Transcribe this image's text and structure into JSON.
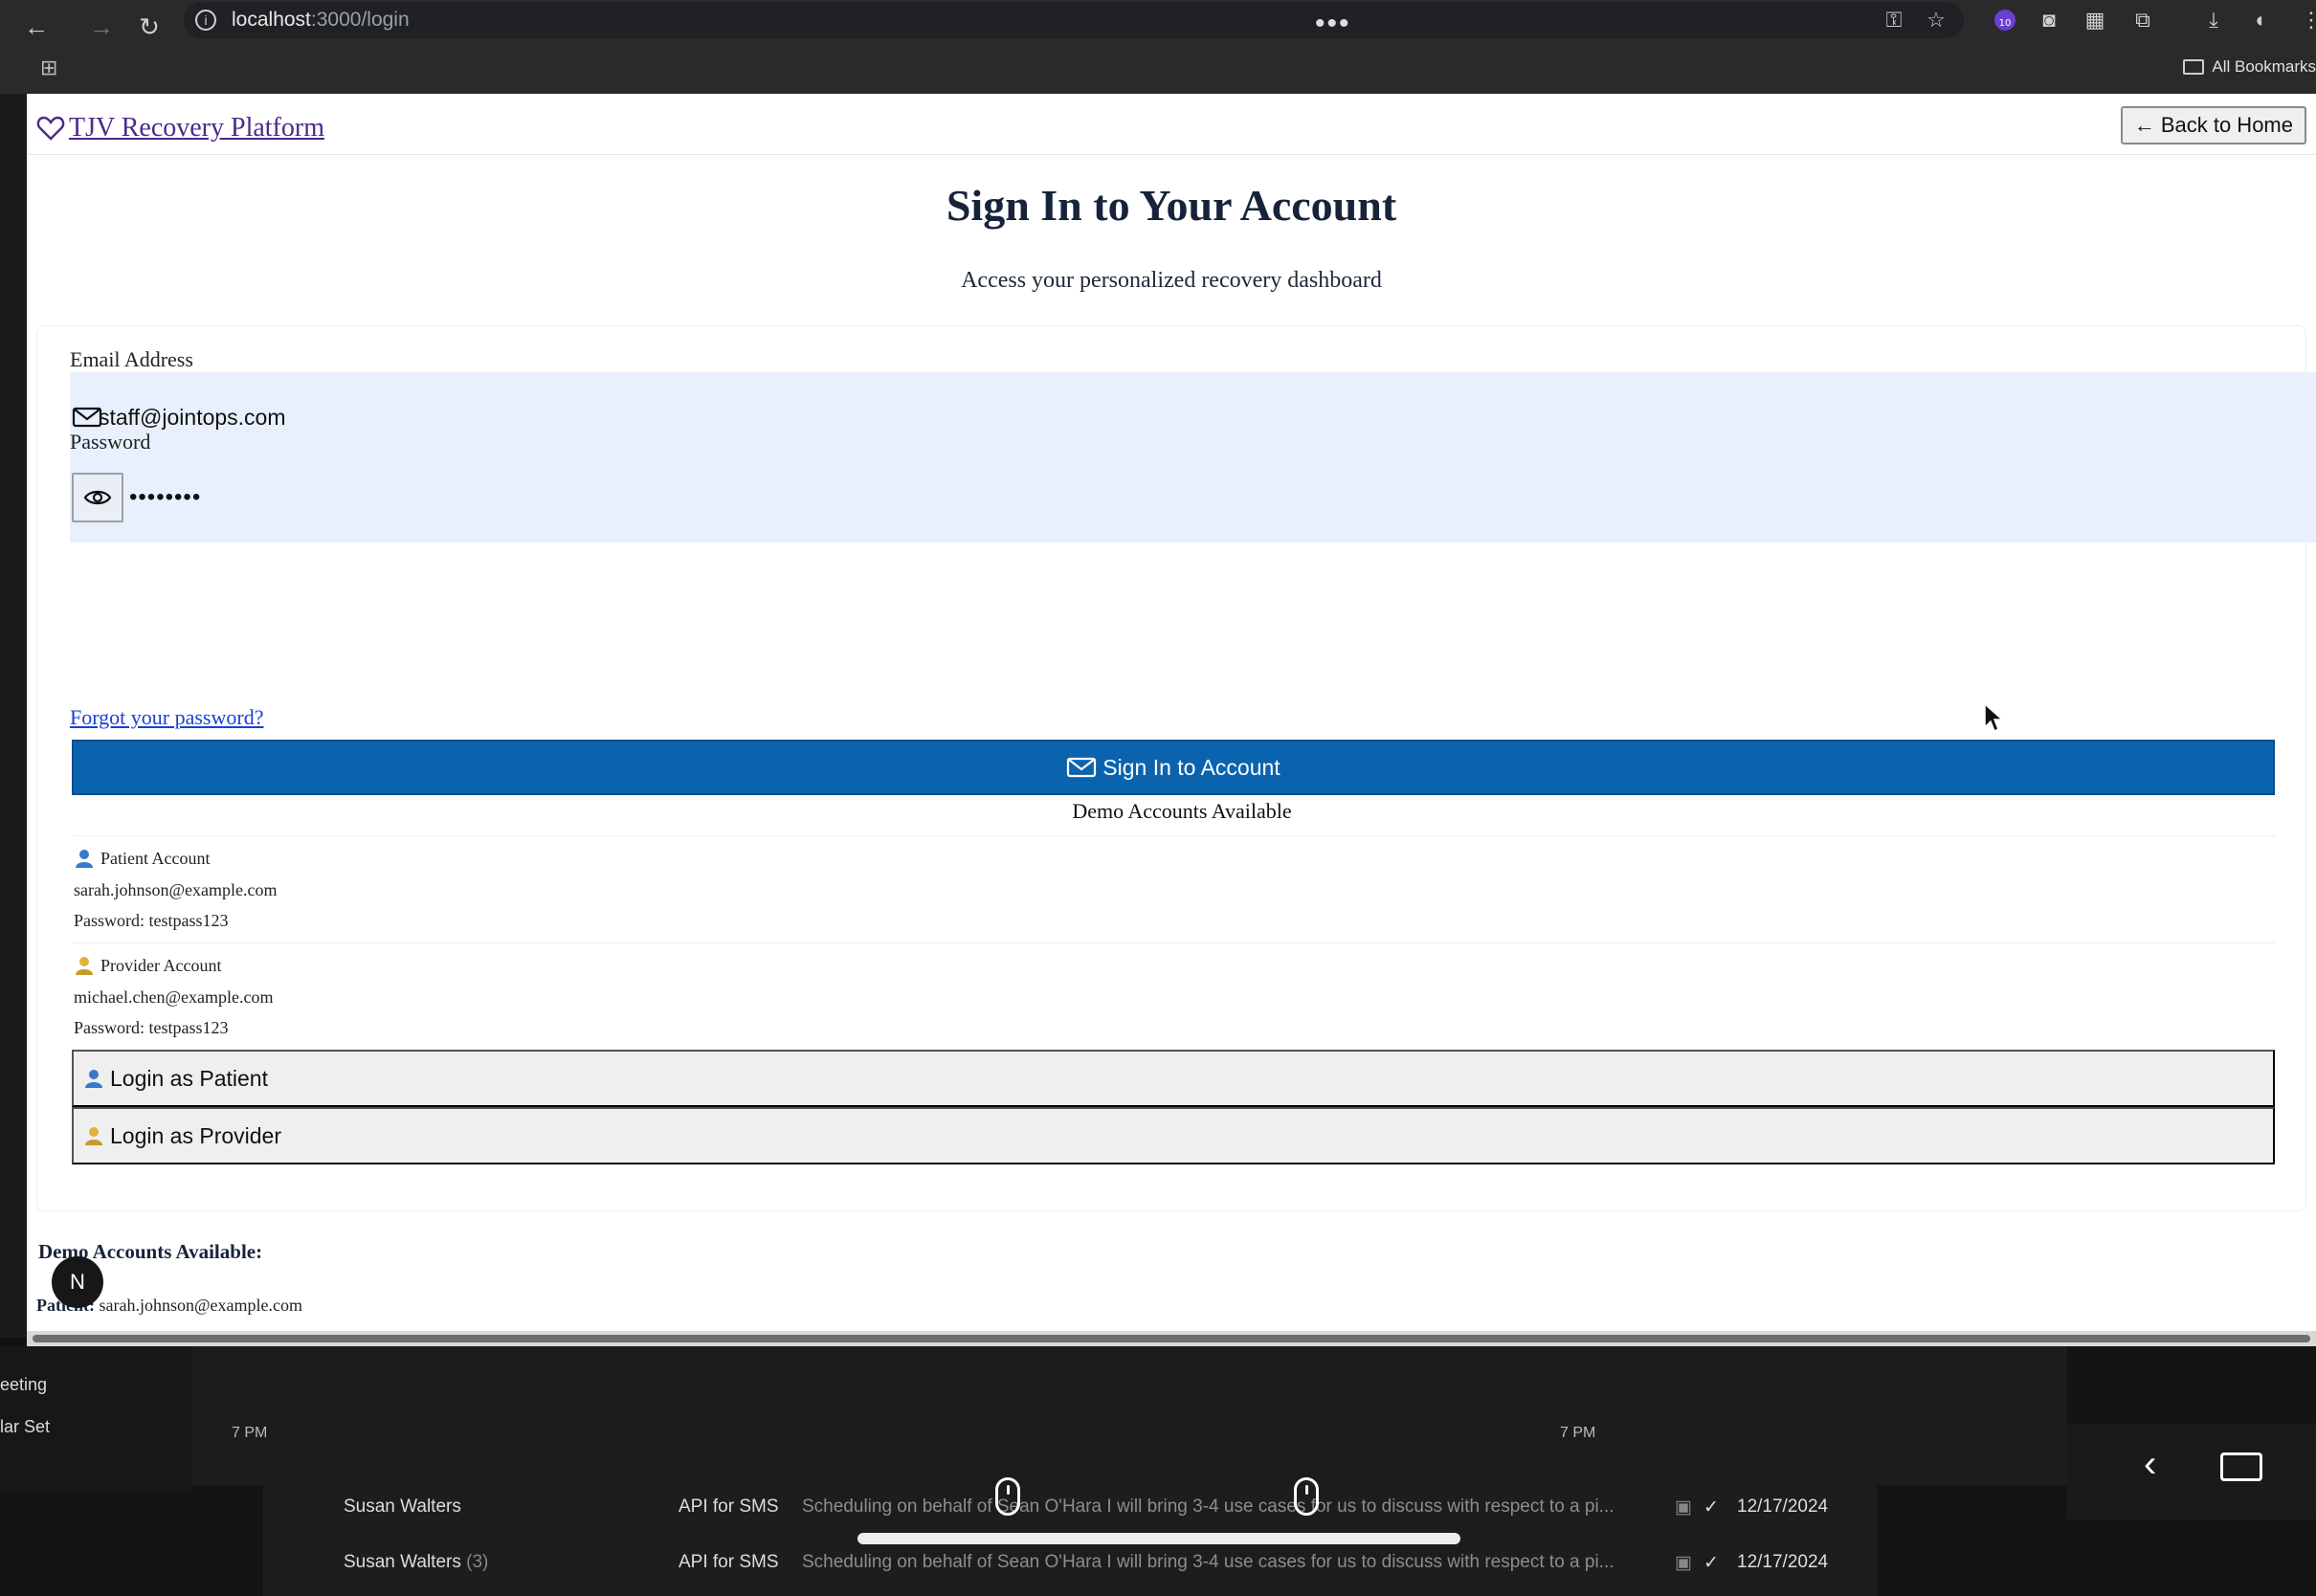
{
  "browser": {
    "url_host": "localhost",
    "url_path": ":3000/login",
    "bookmarks_label": "All Bookmarks",
    "extension_badge": "10"
  },
  "header": {
    "brand": "TJV Recovery Platform",
    "back_home": "Back to Home"
  },
  "page": {
    "title": "Sign In to Your Account",
    "subtitle": "Access your personalized recovery dashboard"
  },
  "form": {
    "email_label": "Email Address",
    "email_value": "staff@jointops.com",
    "password_label": "Password",
    "password_value": "••••••••",
    "forgot": "Forgot your password?",
    "submit": "Sign In to Account"
  },
  "demo": {
    "title": "Demo Accounts Available",
    "patient": {
      "label": "Patient Account",
      "email": "sarah.johnson@example.com",
      "password": "Password: testpass123"
    },
    "provider": {
      "label": "Provider Account",
      "email": "michael.chen@example.com",
      "password": "Password: testpass123"
    },
    "login_patient": "Login as Patient",
    "login_provider": "Login as Provider"
  },
  "footer_demo": {
    "title": "Demo Accounts Available:",
    "patient_label": "Patient:",
    "patient_email": "sarah.johnson@example.com",
    "badge": "N"
  },
  "background": {
    "left_items": [
      "eeting",
      "lar Set"
    ],
    "time_left": "7 PM",
    "time_right": "7 PM",
    "mail": [
      {
        "sender": "Susan Walters",
        "count": "",
        "subject": "API for SMS",
        "snippet": "Scheduling on behalf of Sean O'Hara I will bring 3-4 use cases for us to discuss with respect to a pi...",
        "date": "12/17/2024"
      },
      {
        "sender": "Susan Walters",
        "count": "(3)",
        "subject": "API for SMS",
        "snippet": "Scheduling on behalf of Sean O'Hara I will bring 3-4 use cases for us to discuss with respect to a pi...",
        "date": "12/17/2024"
      }
    ]
  }
}
